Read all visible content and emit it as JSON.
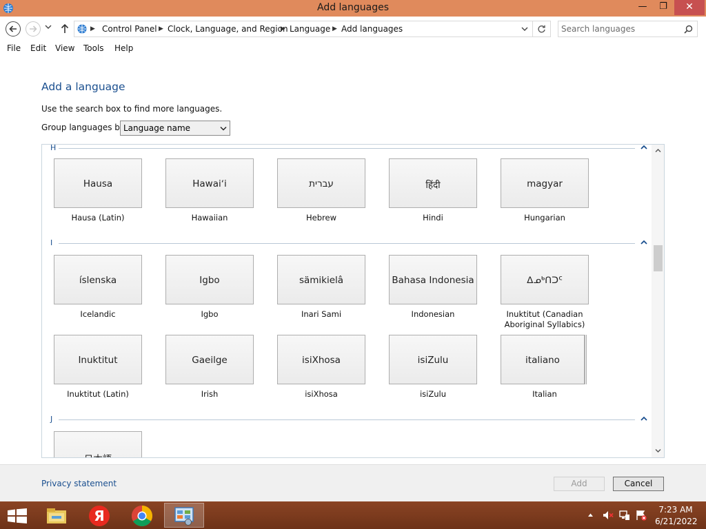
{
  "window": {
    "title": "Add languages",
    "minimize": "—",
    "maximize": "❐",
    "close": "✕"
  },
  "address": {
    "crumbs": [
      "Control Panel",
      "Clock, Language, and Region",
      "Language",
      "Add languages"
    ],
    "search_placeholder": "Search languages"
  },
  "menu": [
    "File",
    "Edit",
    "View",
    "Tools",
    "Help"
  ],
  "content": {
    "title": "Add a language",
    "hint": "Use the search box to find more languages.",
    "group_label": "Group languages by:",
    "group_value": "Language name"
  },
  "groups": [
    {
      "letter": "H",
      "rows": [
        [
          {
            "native": "Hausa",
            "name": "Hausa (Latin)"
          },
          {
            "native": "Hawaiʻi",
            "name": "Hawaiian"
          },
          {
            "native": "עברית",
            "name": "Hebrew"
          },
          {
            "native": "हिंदी",
            "name": "Hindi"
          },
          {
            "native": "magyar",
            "name": "Hungarian"
          }
        ]
      ]
    },
    {
      "letter": "I",
      "rows": [
        [
          {
            "native": "íslenska",
            "name": "Icelandic"
          },
          {
            "native": "Igbo",
            "name": "Igbo"
          },
          {
            "native": "sämikielâ",
            "name": "Inari Sami"
          },
          {
            "native": "Bahasa Indonesia",
            "name": "Indonesian"
          },
          {
            "native": "ᐃᓄᒃᑎᑐᑦ",
            "name": "Inuktitut (Canadian Aboriginal Syllabics)"
          }
        ],
        [
          {
            "native": "Inuktitut",
            "name": "Inuktitut (Latin)"
          },
          {
            "native": "Gaeilge",
            "name": "Irish"
          },
          {
            "native": "isiXhosa",
            "name": "isiXhosa"
          },
          {
            "native": "isiZulu",
            "name": "isiZulu"
          },
          {
            "native": "italiano",
            "name": "Italian"
          }
        ]
      ]
    },
    {
      "letter": "J",
      "rows": [
        [
          {
            "native": "日本語",
            "name": ""
          }
        ]
      ]
    }
  ],
  "footer": {
    "privacy": "Privacy statement",
    "add": "Add",
    "cancel": "Cancel"
  },
  "taskbar": {
    "time": "7:23 AM",
    "date": "6/21/2022"
  }
}
